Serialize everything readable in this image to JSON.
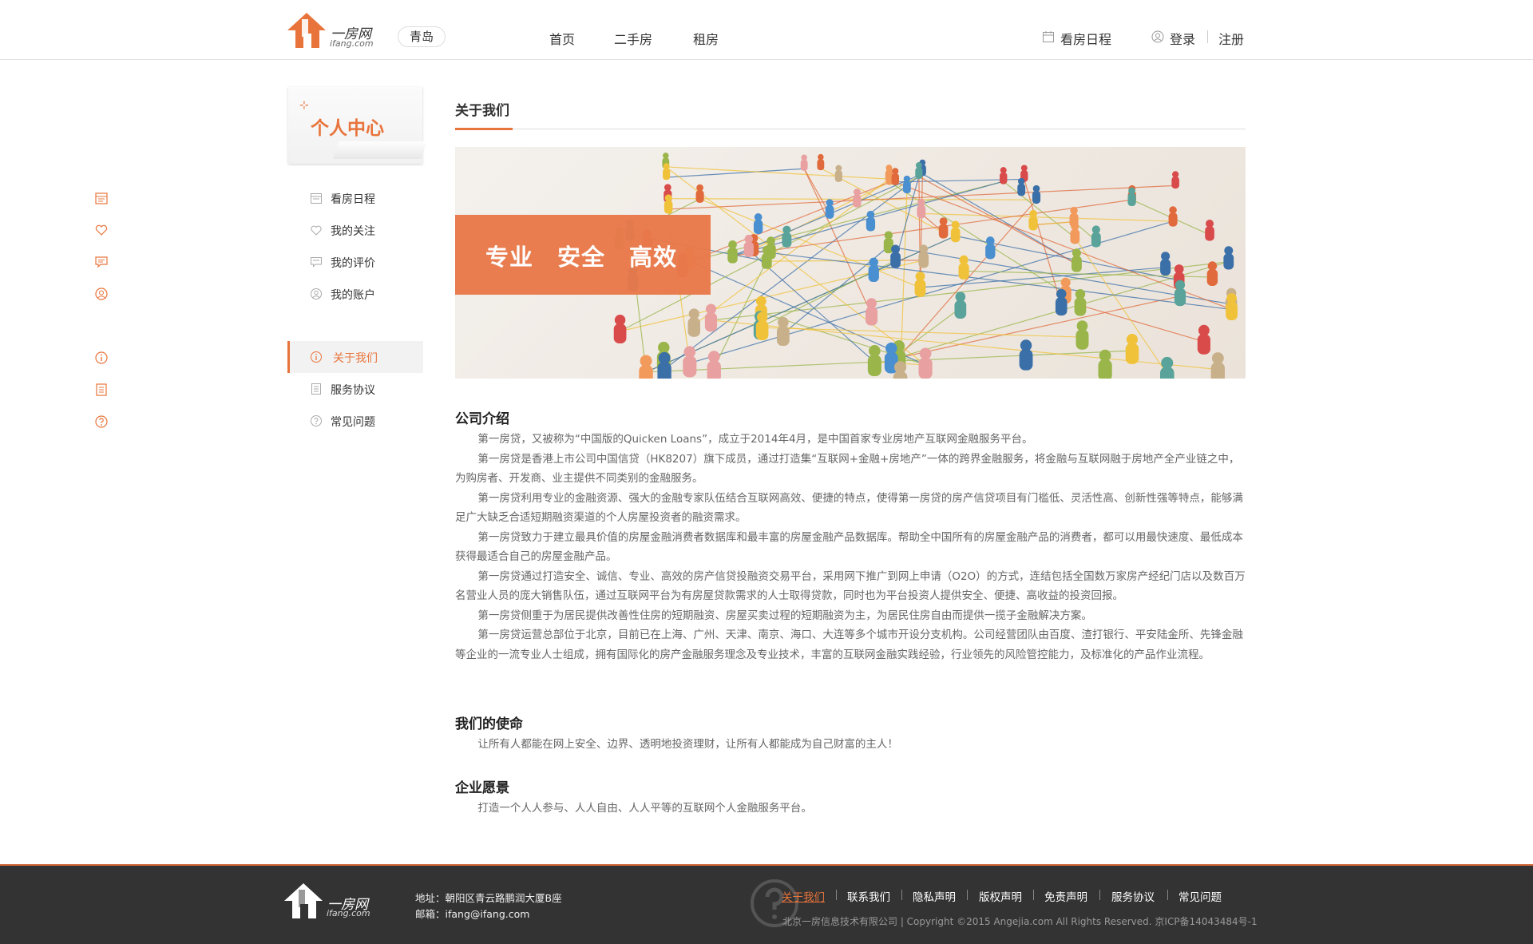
{
  "header": {
    "brand": "一房网",
    "brand_sub": "ifang.com",
    "city": "青岛",
    "nav": [
      "首页",
      "二手房",
      "租房"
    ],
    "schedule": "看房日程",
    "login": "登录",
    "register": "注册"
  },
  "sidebar": {
    "card_title": "个人中心",
    "items": [
      {
        "label": "看房日程",
        "icon": "calendar-icon"
      },
      {
        "label": "我的关注",
        "icon": "heart-icon"
      },
      {
        "label": "我的评价",
        "icon": "comment-icon"
      },
      {
        "label": "我的账户",
        "icon": "user-icon"
      },
      {
        "label": "关于我们",
        "icon": "info-icon"
      },
      {
        "label": "服务协议",
        "icon": "document-icon"
      },
      {
        "label": "常见问题",
        "icon": "question-icon"
      }
    ]
  },
  "content": {
    "title": "关于我们",
    "banner_text": "专业　安全　高效",
    "sections": [
      {
        "title": "公司介绍",
        "paragraphs": [
          "第一房贷，又被称为“中国版的Quicken Loans”，成立于2014年4月，是中国首家专业房地产互联网金融服务平台。",
          "第一房贷是香港上市公司中国信贷（HK8207）旗下成员，通过打造集“互联网+金融+房地产”一体的跨界金融服务，将金融与互联网融于房地产全产业链之中，为购房者、开发商、业主提供不同类别的金融服务。",
          "第一房贷利用专业的金融资源、强大的金融专家队伍结合互联网高效、便捷的特点，使得第一房贷的房产信贷项目有门槛低、灵活性高、创新性强等特点，能够满足广大缺乏合适短期融资渠道的个人房屋投资者的融资需求。",
          "第一房贷致力于建立最具价值的房屋金融消费者数据库和最丰富的房屋金融产品数据库。帮助全中国所有的房屋金融产品的消费者，都可以用最快速度、最低成本获得最适合自己的房屋金融产品。",
          "第一房贷通过打造安全、诚信、专业、高效的房产信贷投融资交易平台，采用网下推广到网上申请（O2O）的方式，连结包括全国数万家房产经纪门店以及数百万名营业人员的庞大销售队伍，通过互联网平台为有房屋贷款需求的人士取得贷款，同时也为平台投资人提供安全、便捷、高收益的投资回报。",
          "第一房贷侧重于为居民提供改善性住房的短期融资、房屋买卖过程的短期融资为主，为居民住房自由而提供一揽子金融解决方案。",
          "第一房贷运营总部位于北京，目前已在上海、广州、天津、南京、海口、大连等多个城市开设分支机构。公司经营团队由百度、渣打银行、平安陆金所、先锋金融等企业的一流专业人士组成，拥有国际化的房产金融服务理念及专业技术，丰富的互联网金融实践经验，行业领先的风险管控能力，及标准化的产品作业流程。"
        ]
      },
      {
        "title": "我们的使命",
        "paragraphs": [
          "让所有人都能在网上安全、边界、透明地投资理财，让所有人都能成为自己财富的主人！"
        ]
      },
      {
        "title": "企业愿景",
        "paragraphs": [
          "打造一个人人参与、人人自由、人人平等的互联网个人金融服务平台。"
        ]
      }
    ]
  },
  "footer": {
    "address": "地址：朝阳区青云路鹏润大厦B座",
    "email": "邮箱：ifang@ifang.com",
    "links": [
      "关于我们",
      "联系我们",
      "隐私声明",
      "版权声明",
      "免责声明",
      "服务协议",
      "常见问题"
    ],
    "copyright": "北京一房信息技术有限公司 | Copyright ©2015 Angejia.com All Rights Reserved. 京ICP备14043484号-1"
  },
  "colors": {
    "accent": "#e8743b",
    "footer_bg": "#333333"
  }
}
